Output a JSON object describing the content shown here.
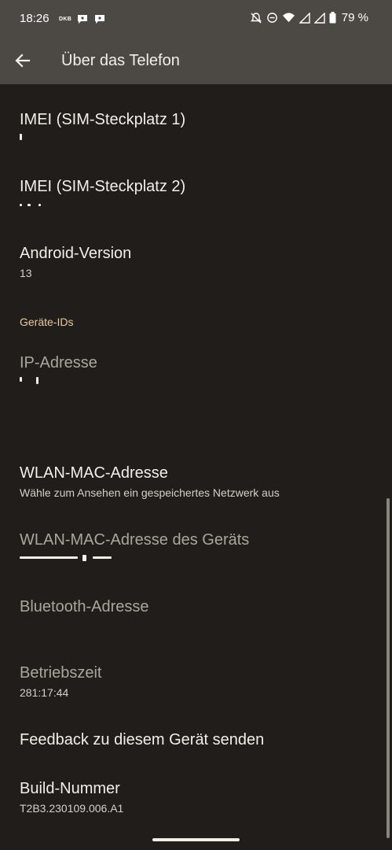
{
  "status_bar": {
    "time": "18:26",
    "carrier_badge": "DKB",
    "battery_percent": "79 %",
    "icons": [
      "chat-bubble-icon",
      "chat-bubble-icon",
      "mute-icon",
      "dnd-icon",
      "wifi-icon",
      "signal-icon",
      "signal-icon",
      "battery-icon"
    ]
  },
  "app_bar": {
    "title": "Über das Telefon",
    "back_icon": "arrow-back-icon"
  },
  "list": {
    "imei1": {
      "title": "IMEI (SIM-Steckplatz 1)"
    },
    "imei2": {
      "title": "IMEI (SIM-Steckplatz 2)"
    },
    "android_version": {
      "title": "Android-Version",
      "summary": "13"
    },
    "section_device_ids": "Geräte-IDs",
    "ip_address": {
      "title": "IP-Adresse"
    },
    "wlan_mac": {
      "title": "WLAN-MAC-Adresse",
      "summary": "Wähle zum Ansehen ein gespeichertes Netzwerk aus"
    },
    "wlan_mac_device": {
      "title": "WLAN-MAC-Adresse des Geräts"
    },
    "bluetooth": {
      "title": "Bluetooth-Adresse"
    },
    "uptime": {
      "title": "Betriebszeit",
      "summary": "281:17:44"
    },
    "feedback": {
      "title": "Feedback zu diesem Gerät senden"
    },
    "build": {
      "title": "Build-Nummer",
      "summary": "T2B3.230109.006.A1"
    }
  },
  "colors": {
    "background": "#201d1a",
    "app_bar": "#4c4844",
    "text_primary": "#f2eee8",
    "text_disabled": "#aba59c",
    "section_accent": "#e9c9a4"
  }
}
